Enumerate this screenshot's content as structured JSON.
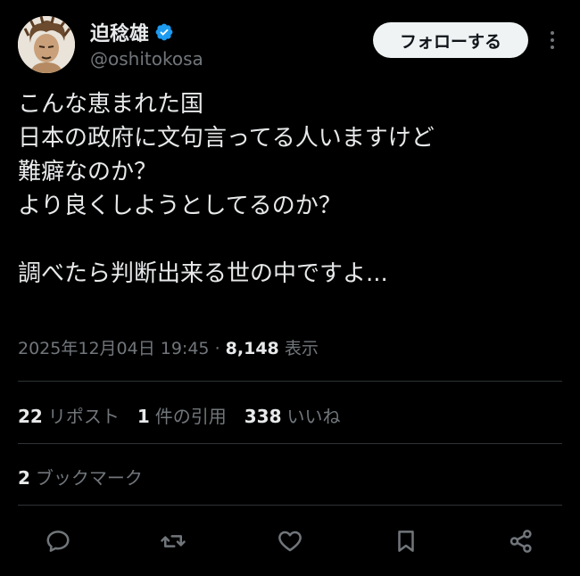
{
  "author": {
    "display_name": "迫稔雄",
    "handle": "@oshitokosa",
    "verified_icon": "verified-badge-icon",
    "verified_color": "#1d9bf0"
  },
  "follow_button": {
    "label": "フォローする"
  },
  "more_button": {
    "icon": "more-vertical-icon"
  },
  "tweet": {
    "lines": [
      "こんな恵まれた国",
      "日本の政府に文句言ってる人いますけど",
      "難癖なのか？",
      "より良くしようとしてるのか？",
      "",
      "調べたら判断出来る世の中ですよ..."
    ]
  },
  "meta": {
    "timestamp": "2025年12月04日 19:45",
    "separator": "·",
    "views_count": "8,148",
    "views_label": "表示"
  },
  "stats": {
    "reposts": {
      "count": "22",
      "label": "リポスト"
    },
    "quotes": {
      "count": "1",
      "label": "件の引用"
    },
    "likes": {
      "count": "338",
      "label": "いいね"
    }
  },
  "bookmarks": {
    "count": "2",
    "label": "ブックマーク"
  },
  "actions": [
    {
      "icon": "reply-icon"
    },
    {
      "icon": "repost-icon"
    },
    {
      "icon": "like-icon"
    },
    {
      "icon": "bookmark-icon"
    },
    {
      "icon": "share-icon"
    }
  ],
  "colors": {
    "background": "#000000",
    "text": "#e7e9ea",
    "secondary_text": "#71767b",
    "divider": "#2f3336",
    "follow_button_bg": "#eff3f4"
  }
}
